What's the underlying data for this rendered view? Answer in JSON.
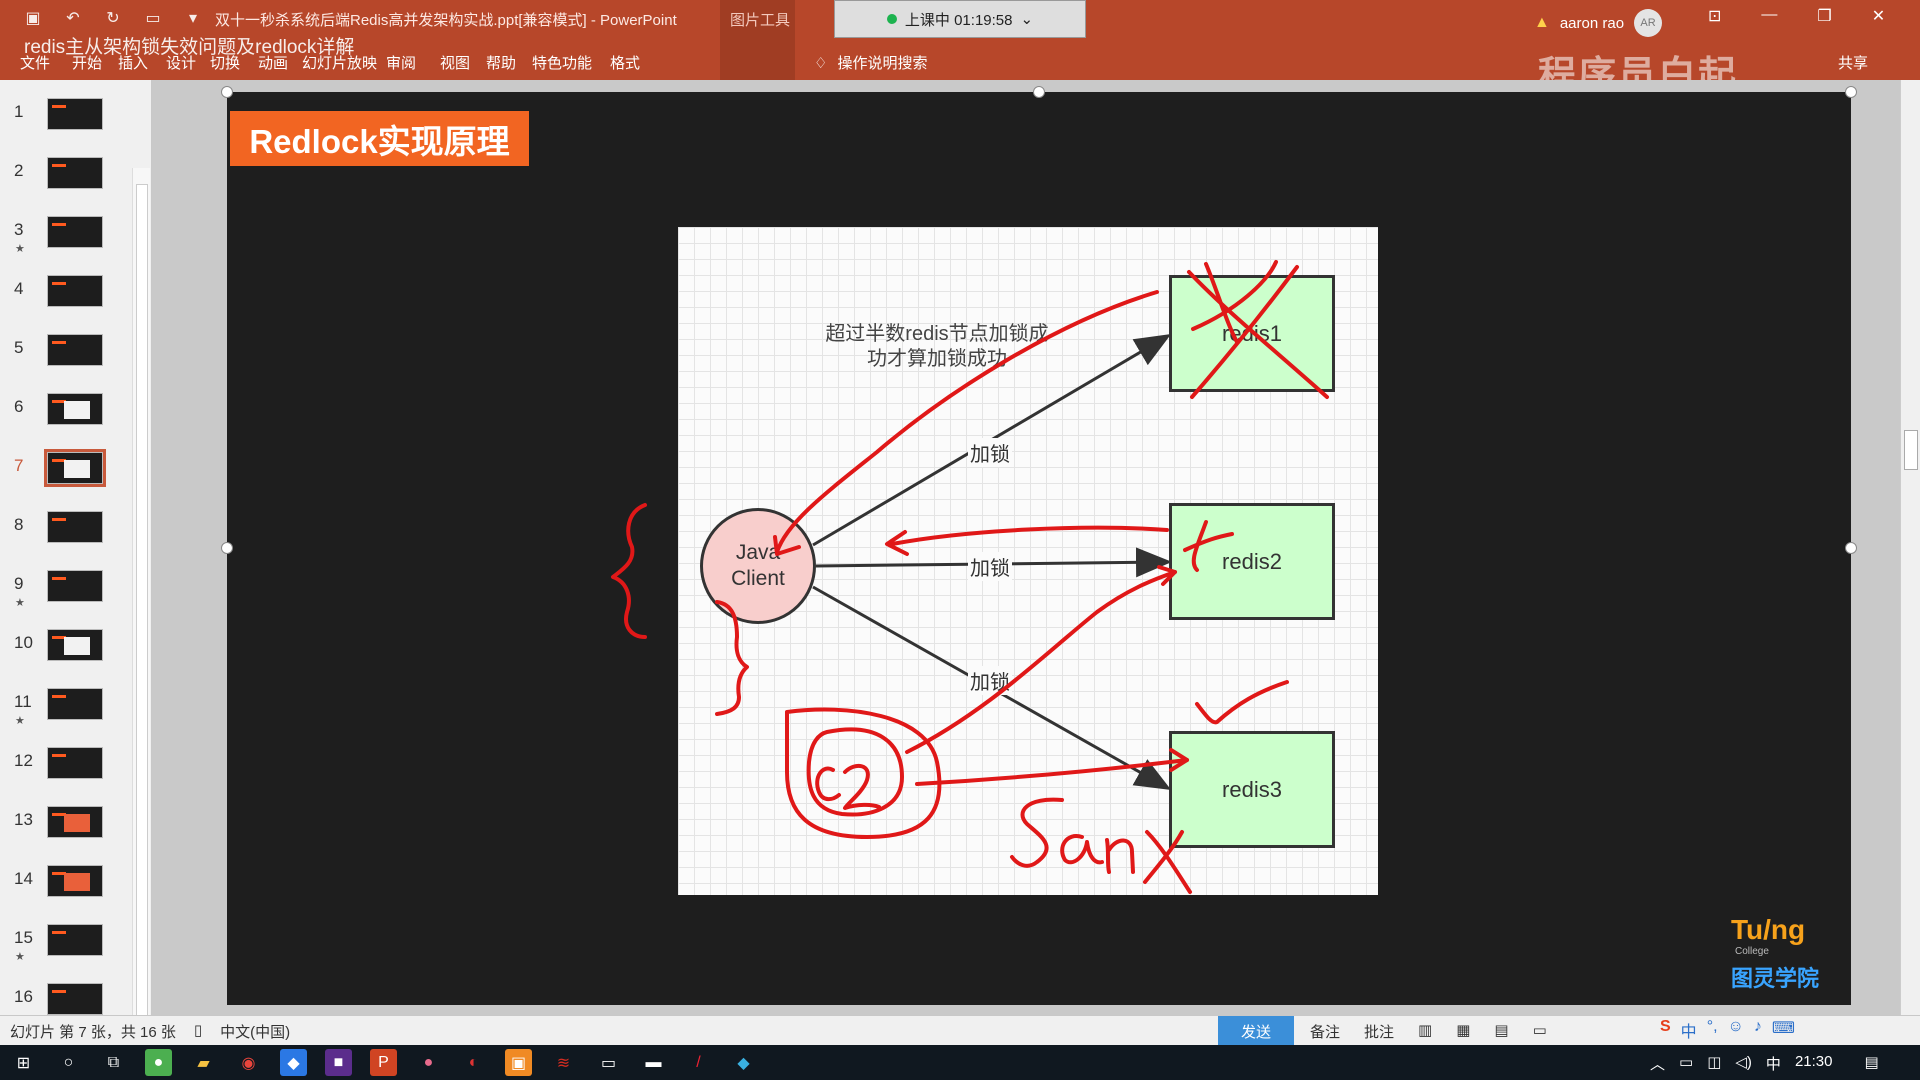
{
  "titlebar": {
    "doc_title": "双十一秒杀系统后端Redis高并发架构实战.ppt[兼容模式]  -  PowerPoint",
    "tools_label": "图片工具",
    "session_label": "上课中 01:19:58",
    "session_chevron": "⌄",
    "user_name": "aaron rao",
    "user_initials": "AR",
    "overlay_subtitle": "redis主从架构锁失效问题及redlock详解",
    "brand_watermark": "程序员白起",
    "share_label": "共享"
  },
  "ribbon": {
    "tabs": [
      "文件",
      "开始",
      "插入",
      "设计",
      "切换",
      "动画",
      "幻灯片放映",
      "审阅",
      "视图",
      "帮助",
      "特色功能",
      "格式"
    ],
    "search_label": "操作说明搜索"
  },
  "thumbnails": [
    {
      "num": "1",
      "star": ""
    },
    {
      "num": "2",
      "star": ""
    },
    {
      "num": "3",
      "star": "★"
    },
    {
      "num": "4",
      "star": ""
    },
    {
      "num": "5",
      "star": ""
    },
    {
      "num": "6",
      "star": ""
    },
    {
      "num": "7",
      "star": ""
    },
    {
      "num": "8",
      "star": ""
    },
    {
      "num": "9",
      "star": "★"
    },
    {
      "num": "10",
      "star": ""
    },
    {
      "num": "11",
      "star": "★"
    },
    {
      "num": "12",
      "star": ""
    },
    {
      "num": "13",
      "star": ""
    },
    {
      "num": "14",
      "star": ""
    },
    {
      "num": "15",
      "star": "★"
    },
    {
      "num": "16",
      "star": ""
    }
  ],
  "slide": {
    "title": "Redlock实现原理",
    "note_line1": "超过半数redis节点加锁成",
    "note_line2": "功才算加锁成功",
    "edge_label": "加锁",
    "client_line1": "Java",
    "client_line2": "Client",
    "nodes": [
      "redis1",
      "redis2",
      "redis3"
    ],
    "tuling_logo": "Tu/ng",
    "tuling_college": "College",
    "tuling_name": "图灵学院"
  },
  "statusbar": {
    "slide_info": "幻灯片 第 7 张，共 16 张",
    "language": "中文(中国)",
    "send": "发送",
    "notes": "备注",
    "comments": "批注",
    "ime_brand": "S",
    "ime_lang": "中"
  },
  "taskbar": {
    "ime": "中",
    "clock": "21:30"
  }
}
